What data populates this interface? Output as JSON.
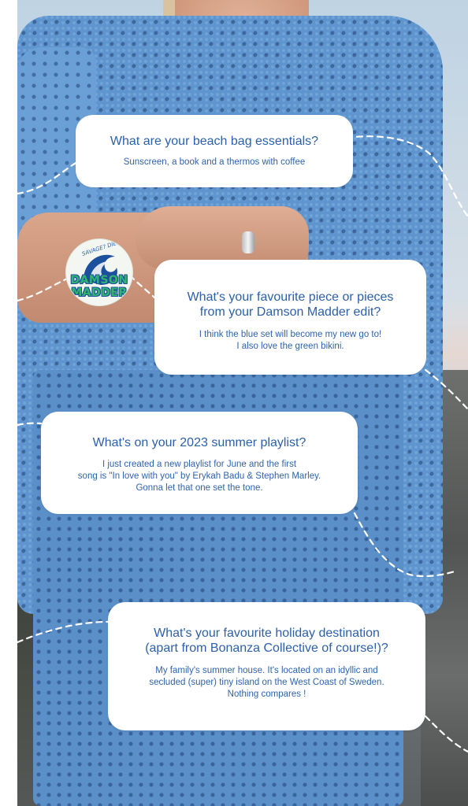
{
  "colors": {
    "card_background": "#ffffff",
    "text_blue": "#2f63ad",
    "shirt_blue": "#5e95cf",
    "logo_green": "#2fb56e",
    "logo_blue": "#1c4f9c"
  },
  "logo": {
    "tagline": "SAVAGE? DIE",
    "word1": "DAMSON",
    "word2": "MADDER",
    "icon": "wave-icon"
  },
  "qa": [
    {
      "question": "What are your beach bag essentials?",
      "answer_lines": [
        "Sunscreen, a book and a thermos with coffee"
      ]
    },
    {
      "question_lines": [
        "What's your favourite piece or pieces",
        "from your Damson Madder edit?"
      ],
      "answer_lines": [
        "I think the blue set will become my new go to!",
        "I also love the green bikini."
      ]
    },
    {
      "question": "What's on your 2023 summer playlist?",
      "answer_lines": [
        "I just created a new playlist for June and the first",
        "song is \"In love with you\" by Erykah Badu & Stephen Marley.",
        "Gonna let that one set the tone."
      ]
    },
    {
      "question_lines": [
        "What's your favourite holiday destination",
        "(apart from Bonanza Collective of course!)?"
      ],
      "answer_lines": [
        "My family's summer house. It's located on an idyllic and",
        "secluded (super) tiny island on the West Coast of Sweden.",
        "Nothing compares !"
      ]
    }
  ]
}
